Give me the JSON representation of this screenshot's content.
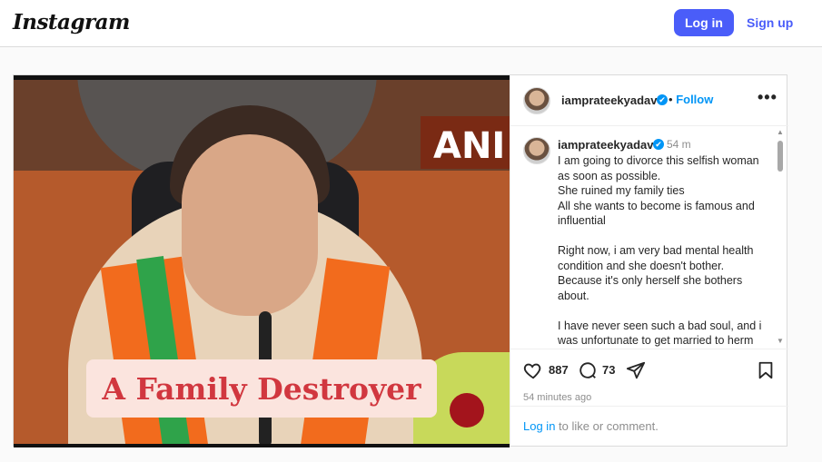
{
  "topbar": {
    "logo": "Instagram",
    "login_label": "Log in",
    "signup_label": "Sign up"
  },
  "media": {
    "sign_text": "ANI",
    "caption_overlay": "A Family Destroyer"
  },
  "post_header": {
    "username": "iamprateekyadav",
    "verified_mark": "✔",
    "separator": "•",
    "follow_label": "Follow",
    "more_icon": "•••"
  },
  "comment": {
    "username": "iamprateekyadav",
    "time": "54 m",
    "paragraphs": [
      "I am going to divorce this selfish woman as soon as possible.\nShe ruined my family ties\nAll she wants to become is famous and influential",
      "Right now, i am very bad mental health condition and she doesn't bother.\nBecause it's only herself she bothers about.",
      "I have never seen such a bad soul, and i was unfortunate to get married to herm"
    ]
  },
  "actions": {
    "likes": "887",
    "comments": "73",
    "time_ago": "54 minutes ago"
  },
  "footer": {
    "login_link": "Log in",
    "rest": " to like or comment."
  },
  "icons": {
    "heart": "heart-icon",
    "comment": "comment-icon",
    "share": "share-icon",
    "bookmark": "bookmark-icon"
  },
  "colors": {
    "primary_button": "#4a5df9",
    "link_blue": "#0095f6",
    "caption_text": "#d1373f"
  }
}
